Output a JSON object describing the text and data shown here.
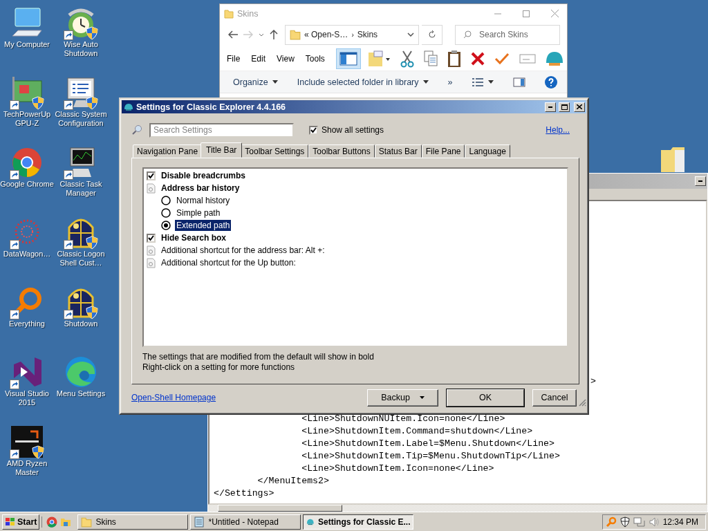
{
  "desktop_icons": [
    {
      "label": "My Computer",
      "shortcut": false,
      "shield": false
    },
    {
      "label": "Wise Auto Shutdown",
      "shortcut": true,
      "shield": true
    },
    {
      "label": "TechPowerUp GPU-Z",
      "shortcut": true,
      "shield": true
    },
    {
      "label": "Classic System Configuration",
      "shortcut": true,
      "shield": true
    },
    {
      "label": "Google Chrome",
      "shortcut": true,
      "shield": false
    },
    {
      "label": "Classic Task Manager",
      "shortcut": true,
      "shield": false
    },
    {
      "label": "DataWagon…",
      "shortcut": true,
      "shield": false
    },
    {
      "label": "Classic Logon Shell Cust…",
      "shortcut": true,
      "shield": true
    },
    {
      "label": "Everything",
      "shortcut": true,
      "shield": false
    },
    {
      "label": "Shutdown",
      "shortcut": true,
      "shield": true
    },
    {
      "label": "Visual Studio 2015",
      "shortcut": true,
      "shield": false
    },
    {
      "label": "Menu Settings",
      "shortcut": false,
      "shield": false
    },
    {
      "label": "AMD Ryzen Master",
      "shortcut": true,
      "shield": true
    }
  ],
  "explorer": {
    "title": "Skins",
    "address": {
      "parent": "« Open-S…",
      "separator": "›",
      "current": "Skins"
    },
    "search": {
      "placeholder": "Search Skins"
    },
    "menu": [
      "File",
      "Edit",
      "View",
      "Tools"
    ],
    "commands": [
      {
        "label": "Organize",
        "dropdown": true
      },
      {
        "label": "Include selected folder in library",
        "dropdown": true
      }
    ],
    "overflow": "»"
  },
  "notepad": {
    "cut_line": ">",
    "lines": [
      "                <Line>ShutdownNUItem.Icon=none</Line>",
      "                <Line>ShutdownItem.Command=shutdown</Line>",
      "                <Line>ShutdownItem.Label=$Menu.Shutdown</Line>",
      "                <Line>ShutdownItem.Tip=$Menu.ShutdownTip</Line>",
      "                <Line>ShutdownItem.Icon=none</Line>",
      "        </MenuItems2>",
      "</Settings>"
    ]
  },
  "dialog": {
    "title": "Settings for Classic Explorer 4.4.166",
    "search": {
      "placeholder": "Search Settings"
    },
    "show_all": {
      "label": "Show all settings",
      "checked": true
    },
    "help": "Help...",
    "tabs": [
      {
        "label": "Navigation Pane",
        "selected": false
      },
      {
        "label": "Title Bar",
        "selected": true
      },
      {
        "label": "Toolbar Settings",
        "selected": false
      },
      {
        "label": "Toolbar Buttons",
        "selected": false
      },
      {
        "label": "Status Bar",
        "selected": false
      },
      {
        "label": "File Pane",
        "selected": false
      },
      {
        "label": "Language",
        "selected": false
      }
    ],
    "settings": [
      {
        "kind": "checkbox",
        "label": "Disable breadcrumbs",
        "checked": true,
        "modified": true
      },
      {
        "kind": "group",
        "label": "Address bar history",
        "modified": true,
        "children": [
          {
            "kind": "radio",
            "label": "Normal history",
            "selected": false,
            "focused": false
          },
          {
            "kind": "radio",
            "label": "Simple path",
            "selected": false,
            "focused": false
          },
          {
            "kind": "radio",
            "label": "Extended path",
            "selected": true,
            "focused": true
          }
        ]
      },
      {
        "kind": "checkbox",
        "label": "Hide Search box",
        "checked": true,
        "modified": true
      },
      {
        "kind": "option",
        "label": "Additional shortcut for the address bar: Alt +:",
        "modified": false
      },
      {
        "kind": "option",
        "label": "Additional shortcut for the Up button:",
        "modified": false
      }
    ],
    "notes": [
      "The settings that are modified from the default will show in bold",
      "Right-click on a setting for more functions"
    ],
    "homepage": "Open-Shell Homepage",
    "buttons": [
      {
        "label": "Backup",
        "dropdown": true,
        "default": false
      },
      {
        "label": "OK",
        "dropdown": false,
        "default": true
      },
      {
        "label": "Cancel",
        "dropdown": false,
        "default": false
      }
    ]
  },
  "taskbar": {
    "start": "Start",
    "tasks": [
      {
        "label": "Skins",
        "selected": false
      },
      {
        "label": "*Untitled - Notepad",
        "selected": false
      },
      {
        "label": "Settings for Classic E...",
        "selected": true
      }
    ],
    "clock": "12:34 PM"
  }
}
